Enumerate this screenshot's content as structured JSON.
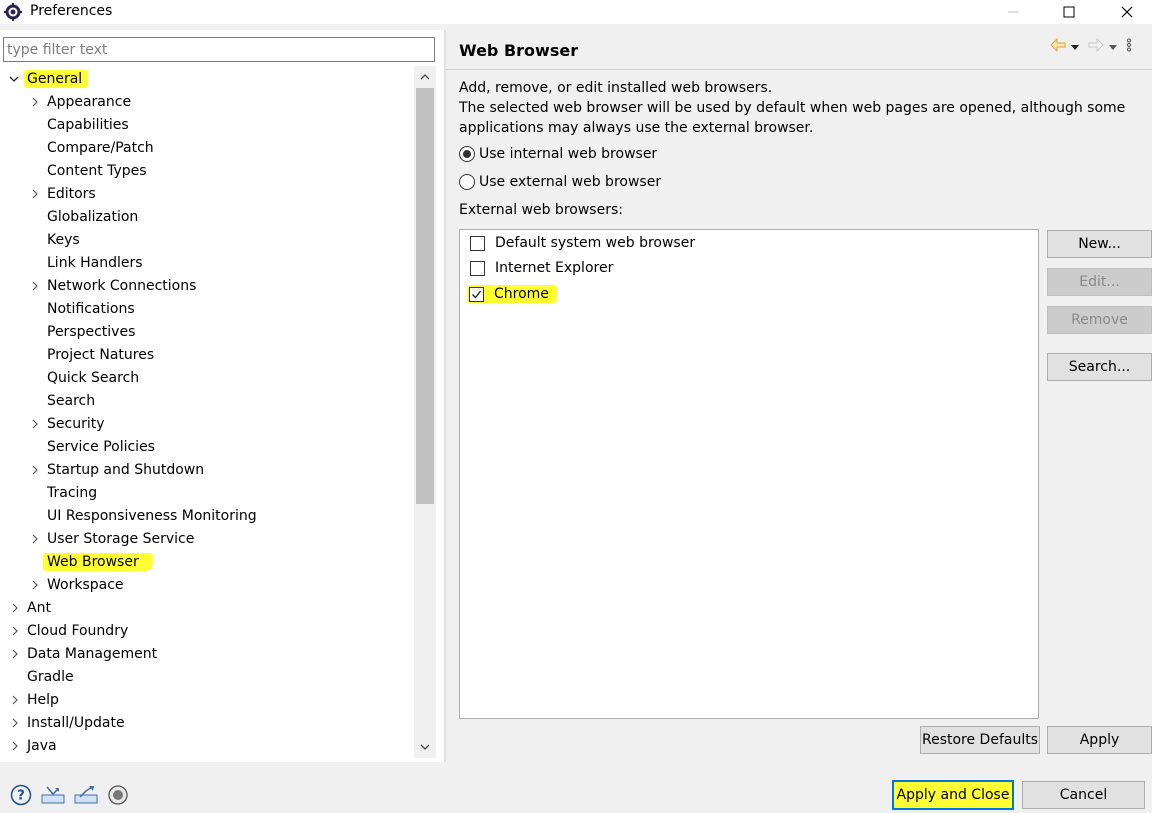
{
  "window": {
    "title": "Preferences"
  },
  "filter": {
    "placeholder": "type filter text",
    "value": ""
  },
  "tree": {
    "root_label": "General",
    "general_children": [
      {
        "label": "Appearance",
        "expandable": true
      },
      {
        "label": "Capabilities",
        "expandable": false
      },
      {
        "label": "Compare/Patch",
        "expandable": false
      },
      {
        "label": "Content Types",
        "expandable": false
      },
      {
        "label": "Editors",
        "expandable": true
      },
      {
        "label": "Globalization",
        "expandable": false
      },
      {
        "label": "Keys",
        "expandable": false
      },
      {
        "label": "Link Handlers",
        "expandable": false
      },
      {
        "label": "Network Connections",
        "expandable": true
      },
      {
        "label": "Notifications",
        "expandable": false
      },
      {
        "label": "Perspectives",
        "expandable": false
      },
      {
        "label": "Project Natures",
        "expandable": false
      },
      {
        "label": "Quick Search",
        "expandable": false
      },
      {
        "label": "Search",
        "expandable": false
      },
      {
        "label": "Security",
        "expandable": true
      },
      {
        "label": "Service Policies",
        "expandable": false
      },
      {
        "label": "Startup and Shutdown",
        "expandable": true
      },
      {
        "label": "Tracing",
        "expandable": false
      },
      {
        "label": "UI Responsiveness Monitoring",
        "expandable": false
      },
      {
        "label": "User Storage Service",
        "expandable": true
      },
      {
        "label": "Web Browser",
        "expandable": false,
        "selected": true
      },
      {
        "label": "Workspace",
        "expandable": true
      }
    ],
    "top_level": [
      {
        "label": "Ant",
        "expandable": true
      },
      {
        "label": "Cloud Foundry",
        "expandable": true
      },
      {
        "label": "Data Management",
        "expandable": true
      },
      {
        "label": "Gradle",
        "expandable": false
      },
      {
        "label": "Help",
        "expandable": true
      },
      {
        "label": "Install/Update",
        "expandable": true
      },
      {
        "label": "Java",
        "expandable": true
      }
    ]
  },
  "page": {
    "title": "Web Browser",
    "desc_line1": "Add, remove, or edit installed web browsers.",
    "desc_line2": "The selected web browser will be used by default when web pages are opened, although some",
    "desc_line3": "applications may always use the external browser.",
    "radio_internal": "Use internal web browser",
    "radio_external": "Use external web browser",
    "selected_mode": "internal",
    "external_label": "External web browsers:",
    "browsers": [
      {
        "label": "Default system web browser",
        "checked": false
      },
      {
        "label": "Internet Explorer",
        "checked": false
      },
      {
        "label": "Chrome",
        "checked": true
      }
    ],
    "buttons": {
      "new": "New...",
      "edit": "Edit...",
      "remove": "Remove",
      "search": "Search...",
      "restore_defaults": "Restore Defaults",
      "apply": "Apply"
    }
  },
  "footer": {
    "apply_and_close": "Apply and Close",
    "cancel": "Cancel"
  },
  "icons": {
    "app": "eclipse-gear-icon",
    "help": "help-icon",
    "import": "import-icon",
    "export": "export-icon",
    "record": "record-icon"
  },
  "colors": {
    "highlight": "#ffff33",
    "focus_border": "#0078d7",
    "nav_arrow": "#d9a441"
  }
}
